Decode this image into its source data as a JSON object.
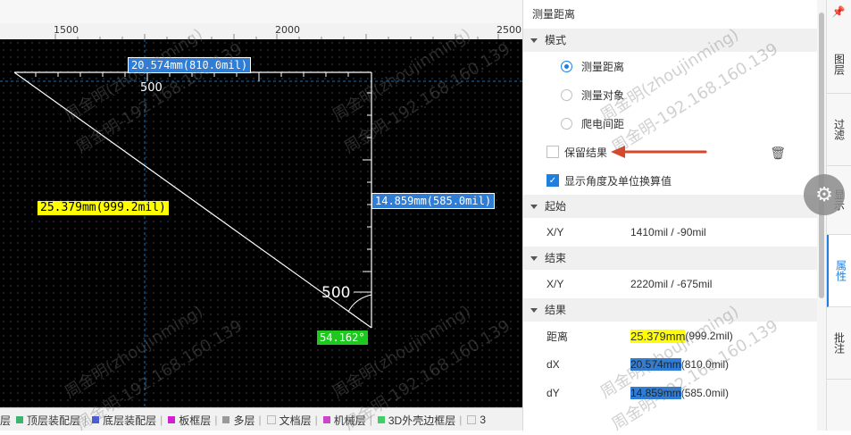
{
  "canvas": {
    "ruler_ticks": [
      "1500",
      "2000",
      "2500"
    ],
    "measure": {
      "dx_label": "20.574mm(810.0mil)",
      "dy_label": "14.859mm(585.0mil)",
      "dist_label": "25.379mm(999.2mil)",
      "angle_label": "54.162°",
      "scale_top": "500",
      "scale_right": "500"
    }
  },
  "layerbar": {
    "items": [
      {
        "label": "层",
        "color": "#888888"
      },
      {
        "label": "顶层装配层",
        "color": "#3cb371"
      },
      {
        "label": "底层装配层",
        "color": "#4b5bd8"
      },
      {
        "label": "板框层",
        "color": "#d020d0"
      },
      {
        "label": "多层",
        "color": "#999999"
      },
      {
        "label": "文档层",
        "color": "#eeeeee"
      },
      {
        "label": "机械层",
        "color": "#cc44cc"
      },
      {
        "label": "3D外壳边框层",
        "color": "#44cc66"
      },
      {
        "label": "3",
        "color": "#eeeeee"
      }
    ]
  },
  "panel": {
    "title": "测量距离",
    "mode_section": "模式",
    "modes": [
      {
        "label": "测量距离",
        "selected": true
      },
      {
        "label": "测量对象",
        "selected": false
      },
      {
        "label": "爬电间距",
        "selected": false
      }
    ],
    "keep_result": {
      "label": "保留结果",
      "checked": false
    },
    "show_angle": {
      "label": "显示角度及单位换算值",
      "checked": true
    },
    "start_section": "起始",
    "start": {
      "key": "X/Y",
      "value": "1410mil / -90mil"
    },
    "end_section": "结束",
    "end": {
      "key": "X/Y",
      "value": "2220mil / -675mil"
    },
    "result_section": "结果",
    "results": {
      "distance": {
        "key": "距离",
        "main": "25.379mm",
        "sub": "(999.2mil)"
      },
      "dx": {
        "key": "dX",
        "main": "20.574mm",
        "sub": "(810.0mil)"
      },
      "dy": {
        "key": "dY",
        "main": "14.859mm",
        "sub": "(585.0mil)"
      }
    }
  },
  "tabs": [
    "图层",
    "过滤",
    "显示",
    "属性",
    "批注"
  ],
  "active_tab": "属性",
  "watermark": {
    "name": "周金明(zhoujinming)",
    "ip": "周金明-192.168.160.139"
  },
  "colors": {
    "accent": "#1f7fe0",
    "arrow": "#d9472b"
  }
}
